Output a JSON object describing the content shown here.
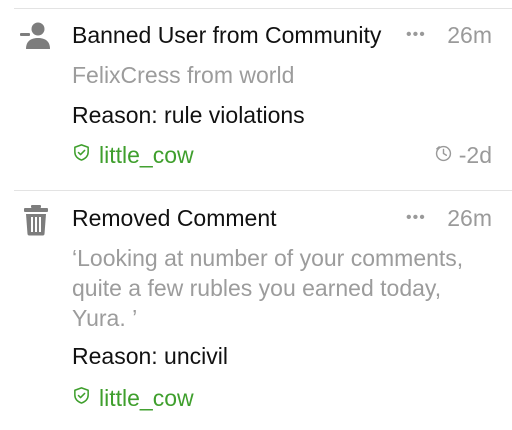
{
  "entries": [
    {
      "icon": "remove-user-icon",
      "title": "Banned User from Community",
      "more": "•••",
      "time": "26m",
      "detail": "FelixCress from world",
      "reason": "Reason: rule violations",
      "moderator": "little_cow",
      "moderator_icon": "shield-check-icon",
      "age_icon": "clock-icon",
      "age": "-2d"
    },
    {
      "icon": "trash-icon",
      "title": "Removed Comment",
      "more": "•••",
      "time": "26m",
      "detail": "‘Looking at number of your comments, quite a few rubles you earned today, Yura. ’",
      "reason": "Reason: uncivil",
      "moderator": "little_cow",
      "moderator_icon": "shield-check-icon"
    }
  ],
  "colors": {
    "moderator": "#3f9f2d",
    "muted": "#9a9a9a",
    "text": "#111111",
    "divider": "#e3e3e3",
    "icon": "#7d7d7d"
  }
}
